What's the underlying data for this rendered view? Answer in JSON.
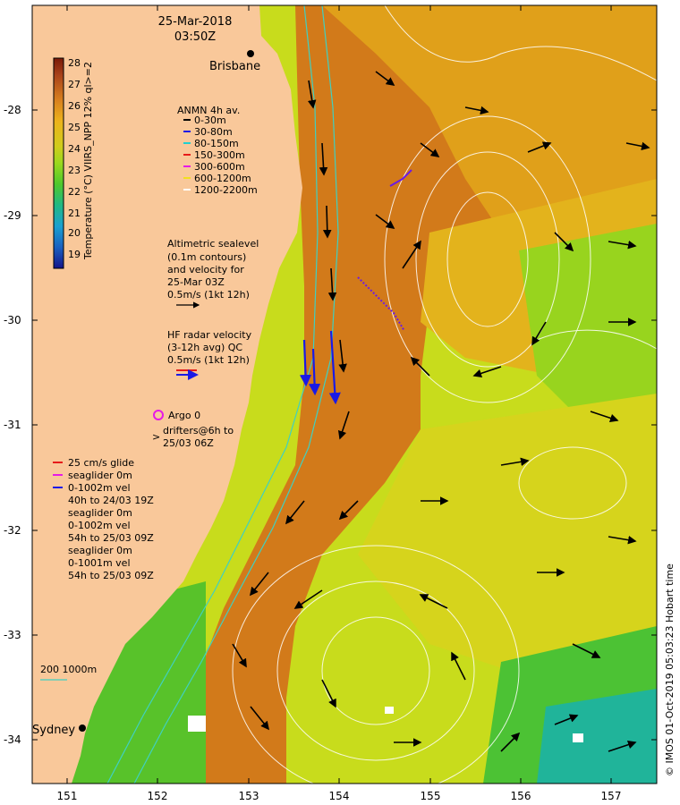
{
  "header": {
    "date": "25-Mar-2018",
    "time": "03:50Z"
  },
  "place_labels": {
    "brisbane": "Brisbane",
    "sydney": "Sydney"
  },
  "axes": {
    "x_ticks": [
      "151",
      "152",
      "153",
      "154",
      "155",
      "156",
      "157"
    ],
    "y_ticks": [
      "-28",
      "-29",
      "-30",
      "-31",
      "-32",
      "-33",
      "-34"
    ]
  },
  "colorbar": {
    "label": "Temperature (°C) VIIRS_NPP 12% ql>=2",
    "ticks": [
      "28",
      "27",
      "26",
      "25",
      "24",
      "23",
      "22",
      "21",
      "20",
      "19"
    ],
    "colors": [
      "#7a1a08",
      "#a8421a",
      "#d8801e",
      "#ecb21c",
      "#d0cc1c",
      "#9ad81e",
      "#4ec82c",
      "#20b884",
      "#1aa0d0",
      "#1a60c0",
      "#14148a"
    ]
  },
  "legend_anmn": {
    "title": "ANMN 4h av.",
    "items": [
      {
        "label": "0-30m",
        "color": "#000000"
      },
      {
        "label": "30-80m",
        "color": "#1a1ae6"
      },
      {
        "label": "80-150m",
        "color": "#20d0d0"
      },
      {
        "label": "150-300m",
        "color": "#e61a1a"
      },
      {
        "label": "300-600m",
        "color": "#e61ae6"
      },
      {
        "label": "600-1200m",
        "color": "#f0e020"
      },
      {
        "label": "1200-2200m",
        "color": "#ffffff"
      }
    ]
  },
  "altimetry_text": [
    "Altimetric sealevel",
    "(0.1m contours)",
    "and velocity for",
    "25-Mar 03Z",
    "0.5m/s (1kt 12h)"
  ],
  "hf_text": [
    "HF radar velocity",
    "(3-12h avg) QC",
    "0.5m/s (1kt 12h)"
  ],
  "argo_text": "Argo 0",
  "drifters_text": [
    "drifters@6h to",
    "25/03 06Z"
  ],
  "glider_legend": {
    "items": [
      {
        "label": "25 cm/s glide",
        "color": "#e61a1a"
      },
      {
        "label": "seaglider 0m",
        "color": "#e61ae6"
      },
      {
        "label": "0-1002m vel",
        "color": "#1a1ae6"
      }
    ],
    "notes": [
      "40h to 24/03 19Z",
      "seaglider 0m",
      "0-1002m vel",
      "54h to 25/03 09Z",
      "seaglider 0m",
      "0-1001m vel",
      "54h to 25/03 09Z"
    ]
  },
  "isobath_label": "200  1000m",
  "credit": "© IMOS 01-Oct-2019 05:03:23 Hobart time"
}
